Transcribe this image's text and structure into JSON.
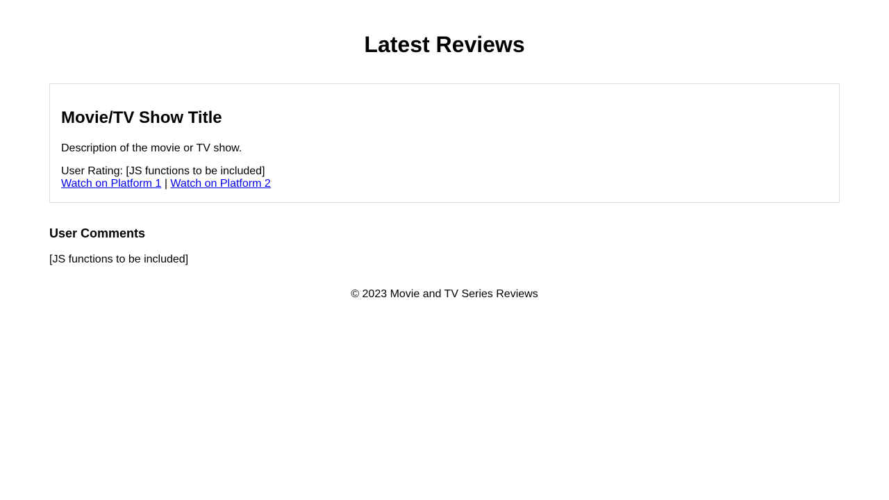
{
  "header": {
    "title": "Latest Reviews"
  },
  "review": {
    "title": "Movie/TV Show Title",
    "description": "Description of the movie or TV show.",
    "rating_label": "User Rating: [JS functions to be included]",
    "platform_1_label": "Watch on Platform 1",
    "separator": "|",
    "platform_2_label": "Watch on Platform 2"
  },
  "comments": {
    "heading": "User Comments",
    "body": "[JS functions to be included]"
  },
  "footer": {
    "text": "© 2023 Movie and TV Series Reviews"
  },
  "colors": {
    "link": "#0000ee",
    "card_border": "#dddddd",
    "text": "#000000",
    "background": "#ffffff"
  }
}
